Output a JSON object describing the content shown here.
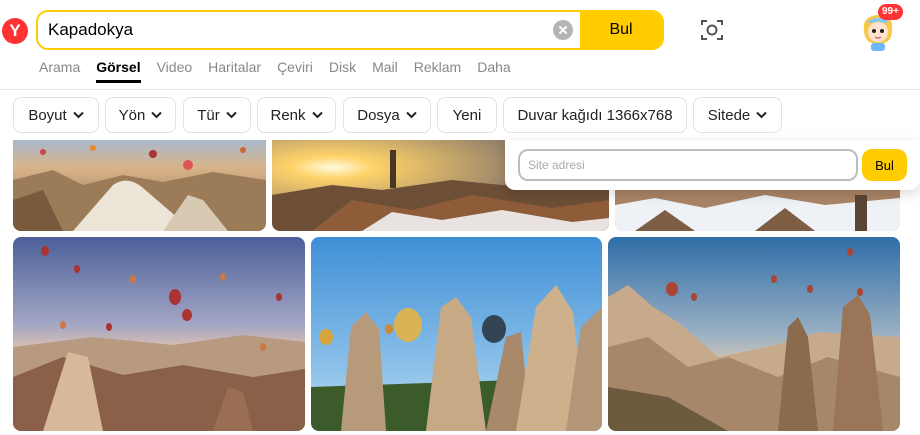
{
  "search": {
    "query": "Kapadokya",
    "button_label": "Bul"
  },
  "logo": {
    "letter": "Y"
  },
  "avatar": {
    "badge": "99+"
  },
  "tabs": [
    {
      "label": "Arama",
      "active": false
    },
    {
      "label": "Görsel",
      "active": true
    },
    {
      "label": "Video",
      "active": false
    },
    {
      "label": "Haritalar",
      "active": false
    },
    {
      "label": "Çeviri",
      "active": false
    },
    {
      "label": "Disk",
      "active": false
    },
    {
      "label": "Mail",
      "active": false
    },
    {
      "label": "Reklam",
      "active": false
    },
    {
      "label": "Daha",
      "active": false
    }
  ],
  "filters": [
    {
      "label": "Boyut",
      "dropdown": true
    },
    {
      "label": "Yön",
      "dropdown": true
    },
    {
      "label": "Tür",
      "dropdown": true
    },
    {
      "label": "Renk",
      "dropdown": true
    },
    {
      "label": "Dosya",
      "dropdown": true
    },
    {
      "label": "Yeni",
      "dropdown": false
    },
    {
      "label": "Duvar kağıdı 1366x768",
      "dropdown": false
    },
    {
      "label": "Sitede",
      "dropdown": true
    }
  ],
  "site_popover": {
    "placeholder": "Site adresi",
    "button_label": "Bul"
  },
  "colors": {
    "accent": "#ffcc00",
    "logo_red": "#ff3333"
  }
}
